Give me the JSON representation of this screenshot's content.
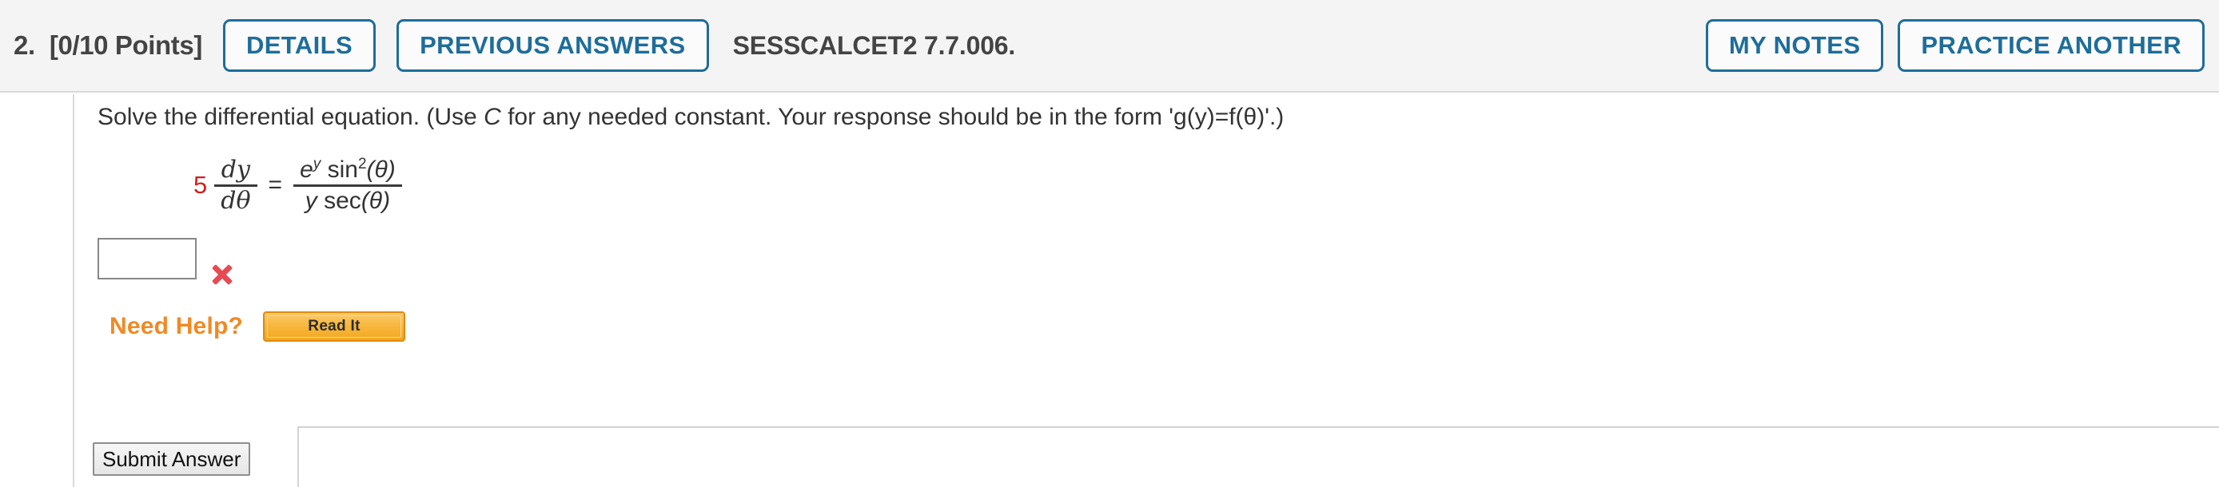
{
  "header": {
    "question_number": "2.",
    "points": "[0/10 Points]",
    "details_label": "DETAILS",
    "previous_answers_label": "PREVIOUS ANSWERS",
    "problem_code": "SESSCALCET2 7.7.006.",
    "my_notes_label": "MY NOTES",
    "practice_another_label": "PRACTICE ANOTHER",
    "button_color": "#1e6d9a"
  },
  "prompt": {
    "part1": "Solve the differential equation. (Use ",
    "constant_symbol": "C",
    "part2": " for any needed constant. Your response should be in the form 'g(y)=f(θ)'.)"
  },
  "equation": {
    "coefficient": "5",
    "coefficient_color": "#d32020",
    "lhs_numerator_d": "d",
    "lhs_numerator_var": "y",
    "lhs_denominator_d": "d",
    "lhs_denominator_var": "θ",
    "equals": "=",
    "rhs_num_e": "e",
    "rhs_num_e_exp": "y",
    "rhs_num_sin": "sin",
    "rhs_num_sin_exp": "2",
    "rhs_num_sin_arg": "(θ)",
    "rhs_den_y": "y",
    "rhs_den_sec": "sec",
    "rhs_den_sec_arg": "(θ)"
  },
  "answer": {
    "value": "",
    "placeholder": "",
    "status": "incorrect",
    "status_color": "#e84a54"
  },
  "help": {
    "label": "Need Help?",
    "label_color": "#f08a24",
    "read_it_label": "Read It"
  },
  "footer": {
    "submit_label": "Submit Answer"
  }
}
